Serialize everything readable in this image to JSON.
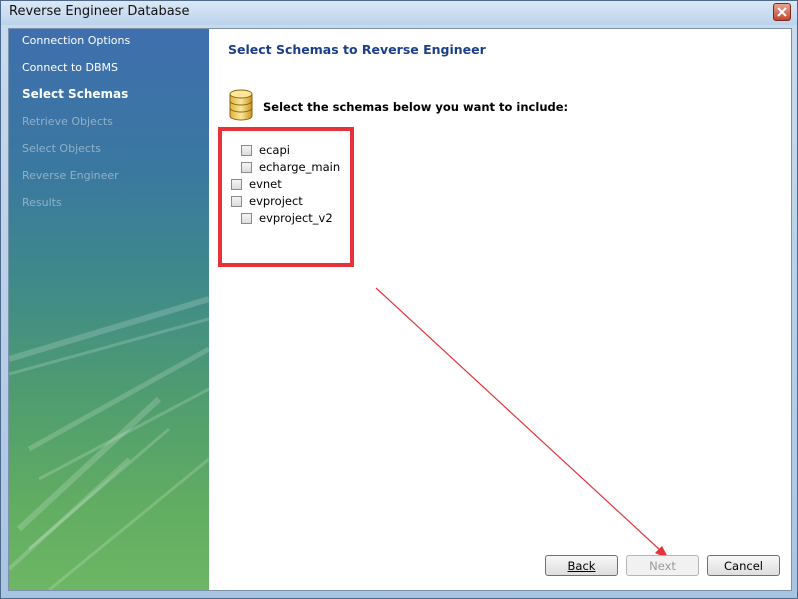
{
  "window": {
    "title": "Reverse Engineer Database"
  },
  "sidebar": {
    "items": [
      {
        "label": "Connection Options",
        "state": "done"
      },
      {
        "label": "Connect to DBMS",
        "state": "done"
      },
      {
        "label": "Select Schemas",
        "state": "active"
      },
      {
        "label": "Retrieve Objects",
        "state": "disabled"
      },
      {
        "label": "Select Objects",
        "state": "disabled"
      },
      {
        "label": "Reverse Engineer",
        "state": "disabled"
      },
      {
        "label": "Results",
        "state": "disabled"
      }
    ]
  },
  "main": {
    "heading": "Select Schemas to Reverse Engineer",
    "instruction": "Select the schemas below you want to include:",
    "icon": "database-icon",
    "schemas": [
      {
        "name": "ecapi",
        "checked": false
      },
      {
        "name": "echarge_main",
        "checked": false
      },
      {
        "name": "evnet",
        "checked": false
      },
      {
        "name": "evproject",
        "checked": false
      },
      {
        "name": "evproject_v2",
        "checked": false
      }
    ]
  },
  "buttons": {
    "back": "Back",
    "next": "Next",
    "cancel": "Cancel"
  },
  "colors": {
    "heading": "#1a3f8a",
    "annotation_red": "#e8323a"
  }
}
